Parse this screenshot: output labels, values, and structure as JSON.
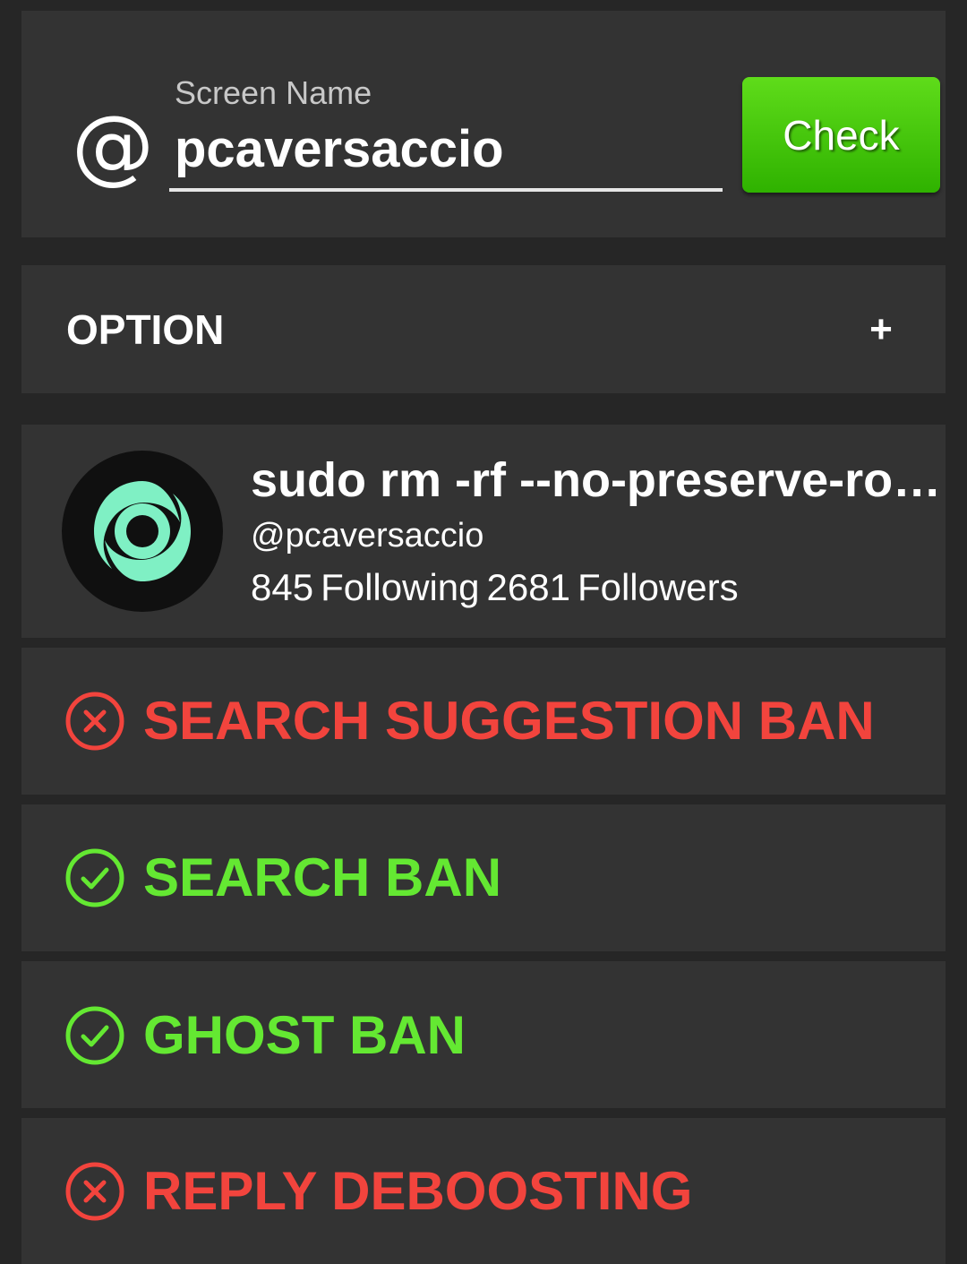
{
  "input": {
    "label": "Screen Name",
    "value": "pcaversaccio",
    "at_symbol": "@",
    "button_label": "Check"
  },
  "option": {
    "title": "OPTION",
    "expand_symbol": "+"
  },
  "profile": {
    "display_name": "sudo rm -rf --no-preserve-ro…",
    "handle": "@pcaversaccio",
    "following_count": "845",
    "following_label": "Following",
    "followers_count": "2681",
    "followers_label": "Followers",
    "avatar_icon": "cyclone-logo-icon"
  },
  "statuses": [
    {
      "label": "SEARCH SUGGESTION BAN",
      "state": "banned",
      "icon": "x-circle-icon"
    },
    {
      "label": "SEARCH BAN",
      "state": "ok",
      "icon": "check-circle-icon"
    },
    {
      "label": "GHOST BAN",
      "state": "ok",
      "icon": "check-circle-icon"
    },
    {
      "label": "REPLY DEBOOSTING",
      "state": "banned",
      "icon": "x-circle-icon"
    }
  ],
  "colors": {
    "background": "#262626",
    "card": "#333333",
    "banned": "#f2443d",
    "ok": "#64e832",
    "button": "#3cc10a",
    "avatar_accent": "#7ff0c4"
  }
}
